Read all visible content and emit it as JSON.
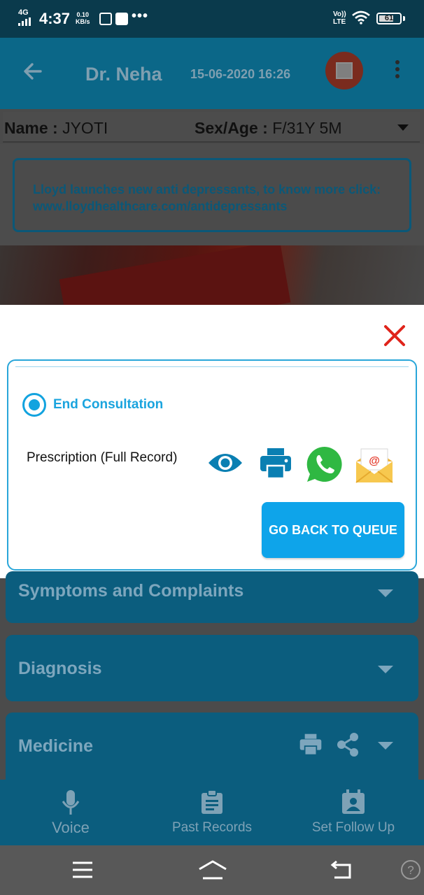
{
  "status_bar": {
    "network": "4G",
    "time": "4:37",
    "speed_value": "0.10",
    "speed_unit": "KB/s",
    "volte": "Vo))",
    "lte": "LTE",
    "battery": "61"
  },
  "header": {
    "doctor_name": "Dr. Neha",
    "session_datetime": "15-06-2020 16:26"
  },
  "patient": {
    "name_label": "Name :",
    "name_value": "JYOTI",
    "sex_age_label": "Sex/Age :",
    "sex_age_value": "F/31Y 5M"
  },
  "ad_banner": {
    "text": "Lloyd launches new anti depressants, to know more click: www.lloydhealthcare.com/antidepressants"
  },
  "modal": {
    "option_label": "End Consultation",
    "prescription_label": "Prescription (Full Record)",
    "go_back_button": "GO BACK TO QUEUE",
    "colors": {
      "accent": "#12a3df",
      "close": "#e0241b",
      "whatsapp": "#2fb842"
    }
  },
  "sections": [
    {
      "title": "Symptoms and Complaints"
    },
    {
      "title": "Diagnosis"
    },
    {
      "title": "Medicine"
    }
  ],
  "bottom_nav": [
    {
      "label": "Voice",
      "icon": "mic-icon"
    },
    {
      "label": "Past Records",
      "icon": "clipboard-icon"
    },
    {
      "label": "Set Follow Up",
      "icon": "calendar-user-icon"
    }
  ]
}
